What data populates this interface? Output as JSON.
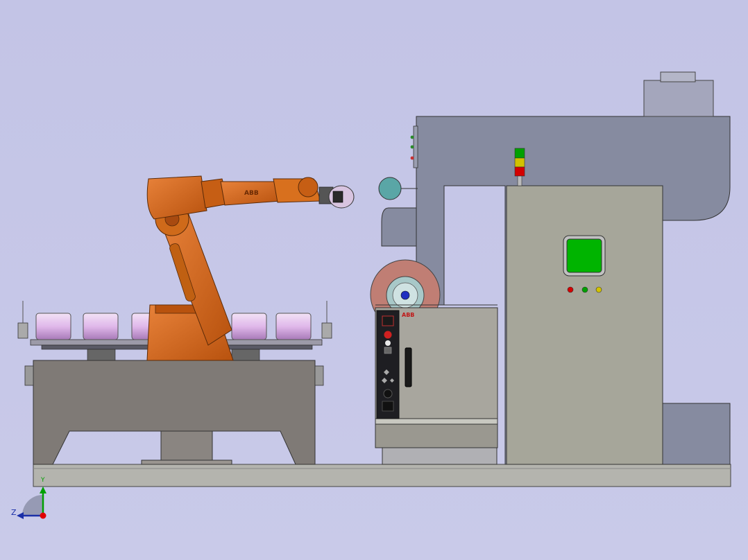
{
  "robot_brand": "ABB",
  "controller_brand": "ABB",
  "triad": {
    "y_label": "Y",
    "z_label": "Z"
  },
  "colors": {
    "background": "#c4c5e7",
    "robot_orange": "#d86a1e",
    "robot_orange_dark": "#a84a10",
    "machine_body": "#8a8ea0",
    "cabinet": "#a6a69a",
    "cabinet_screen": "#00b400",
    "grinding_wheel": "#c07e74",
    "fixture_table": "#7f7a76",
    "workpiece": "#e8c8f0",
    "signal_red": "#d40000",
    "signal_yellow": "#d2c200",
    "signal_green": "#00a000"
  }
}
